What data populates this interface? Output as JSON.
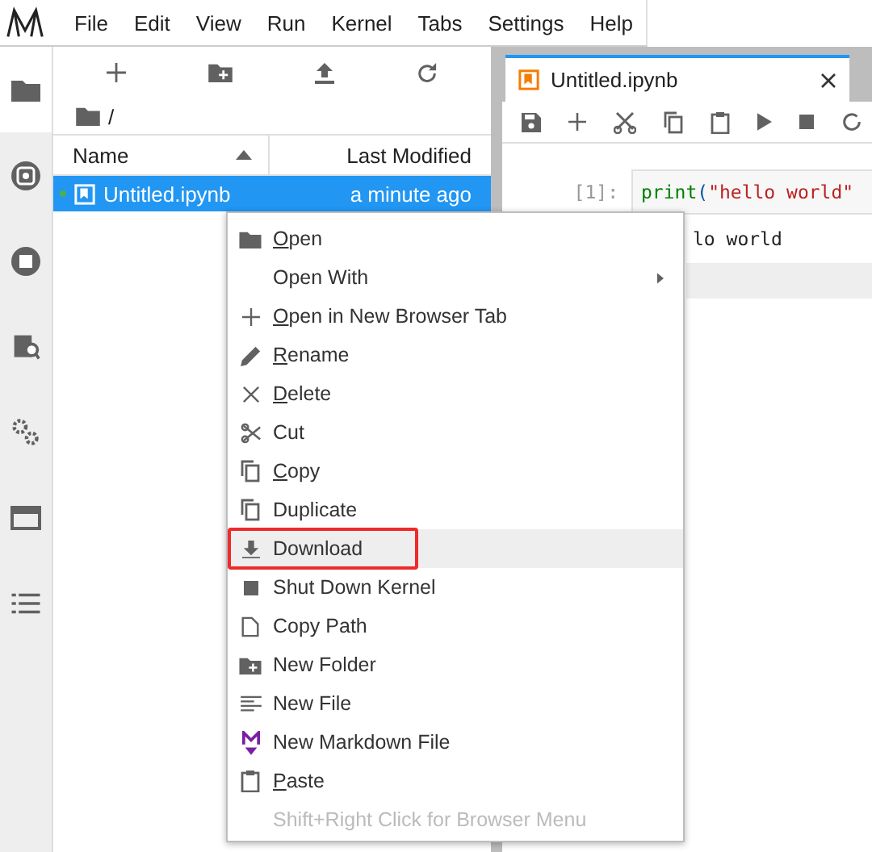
{
  "menubar": {
    "items": [
      "File",
      "Edit",
      "View",
      "Run",
      "Kernel",
      "Tabs",
      "Settings",
      "Help"
    ]
  },
  "sidebar_tabs": [
    {
      "kind": "folder",
      "selected": true
    },
    {
      "kind": "running",
      "selected": false
    },
    {
      "kind": "stop",
      "selected": false
    },
    {
      "kind": "inspector",
      "selected": false
    },
    {
      "kind": "extensions",
      "selected": false
    },
    {
      "kind": "tabs",
      "selected": false
    },
    {
      "kind": "toc",
      "selected": false
    }
  ],
  "file_browser": {
    "breadcrumb": "/",
    "columns": [
      {
        "label": "Name",
        "sorted": true
      },
      {
        "label": "Last Modified",
        "sorted": false
      }
    ],
    "rows": [
      {
        "name": "Untitled.ipynb",
        "modified": "a minute ago",
        "selected": true,
        "running": true
      }
    ]
  },
  "notebook": {
    "tab": {
      "title": "Untitled.ipynb",
      "selected": true
    },
    "cells": [
      {
        "prompt": "[1]:",
        "code": [
          {
            "kind": "builtin",
            "text": "print"
          },
          {
            "kind": "paren",
            "text": "("
          },
          {
            "kind": "string",
            "text": "\"hello world\""
          }
        ],
        "output": "lo world"
      }
    ]
  },
  "context_menu": {
    "items": [
      {
        "kind": "item",
        "label": "Open",
        "underlined": true,
        "selected": false,
        "outlined": false
      },
      {
        "kind": "submenu",
        "label": "Open With",
        "underlined": false,
        "selected": false,
        "outlined": false
      },
      {
        "kind": "item",
        "label": "Open in New Browser Tab",
        "underlined": true,
        "selected": false,
        "outlined": false
      },
      {
        "kind": "item",
        "label": "Rename",
        "underlined": true,
        "selected": false,
        "outlined": false
      },
      {
        "kind": "item",
        "label": "Delete",
        "underlined": true,
        "selected": false,
        "outlined": false
      },
      {
        "kind": "item",
        "label": "Cut",
        "underlined": false,
        "selected": false,
        "outlined": false
      },
      {
        "kind": "item",
        "label": "Copy",
        "underlined": true,
        "selected": false,
        "outlined": false
      },
      {
        "kind": "item",
        "label": "Duplicate",
        "underlined": false,
        "selected": false,
        "outlined": false
      },
      {
        "kind": "item",
        "label": "Download",
        "underlined": false,
        "selected": true,
        "outlined": true
      },
      {
        "kind": "item",
        "label": "Shut Down Kernel",
        "underlined": false,
        "selected": false,
        "outlined": false
      },
      {
        "kind": "item",
        "label": "Copy Path",
        "underlined": false,
        "selected": false,
        "outlined": false
      },
      {
        "kind": "item",
        "label": "New Folder",
        "underlined": false,
        "selected": false,
        "outlined": false
      },
      {
        "kind": "item",
        "label": "New File",
        "underlined": false,
        "selected": false,
        "outlined": false
      },
      {
        "kind": "item",
        "label": "New Markdown File",
        "underlined": false,
        "selected": false,
        "outlined": false
      },
      {
        "kind": "item",
        "label": "Paste",
        "underlined": true,
        "selected": false,
        "outlined": false
      },
      {
        "kind": "hint",
        "label": "Shift+Right Click for Browser Menu",
        "underlined": false,
        "selected": false,
        "outlined": false
      }
    ]
  }
}
